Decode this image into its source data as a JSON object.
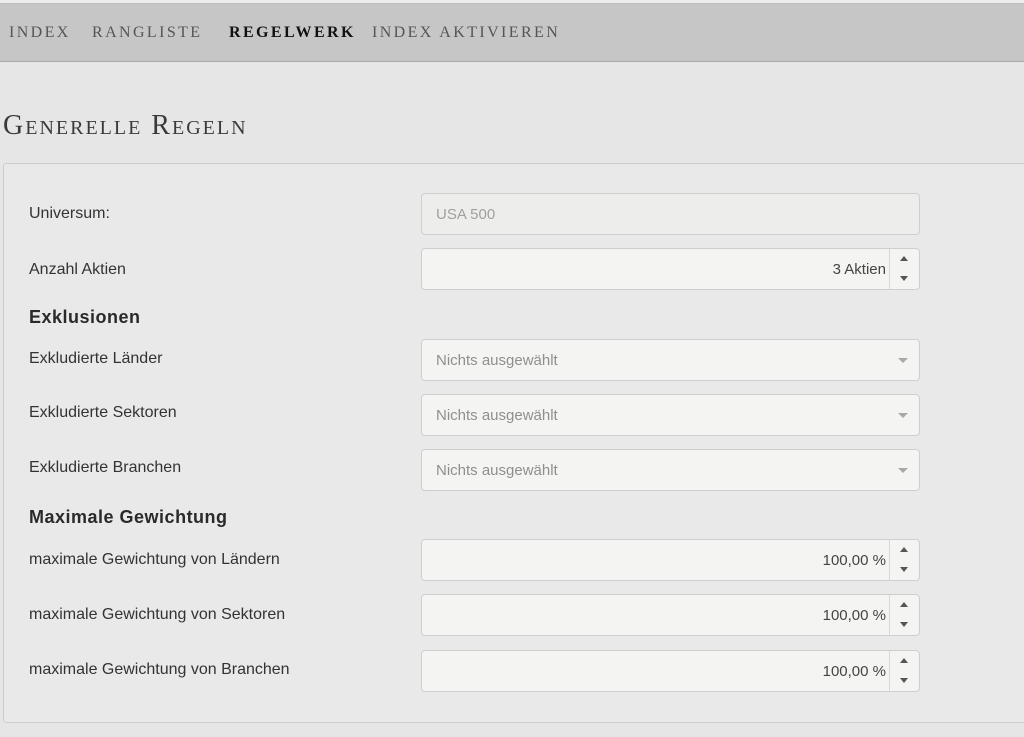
{
  "nav": {
    "items": [
      {
        "label": "INDEX",
        "active": false
      },
      {
        "label": "RANGLISTE",
        "active": false
      },
      {
        "label": "REGELWERK",
        "active": true
      },
      {
        "label": "INDEX AKTIVIEREN",
        "active": false
      }
    ]
  },
  "page_title": "Generelle Regeln",
  "form": {
    "universum": {
      "label": "Universum:",
      "placeholder": "USA 500"
    },
    "anzahl_aktien": {
      "label": "Anzahl Aktien",
      "value": "3 Aktien"
    },
    "exklusionen": {
      "heading": "Exklusionen",
      "laender": {
        "label": "Exkludierte Länder",
        "value": "Nichts ausgewählt"
      },
      "sektoren": {
        "label": "Exkludierte Sektoren",
        "value": "Nichts ausgewählt"
      },
      "branchen": {
        "label": "Exkludierte Branchen",
        "value": "Nichts ausgewählt"
      }
    },
    "max_gewichtung": {
      "heading": "Maximale Gewichtung",
      "laender": {
        "label": "maximale Gewichtung von Ländern",
        "value": "100,00 %"
      },
      "sektoren": {
        "label": "maximale Gewichtung von Sektoren",
        "value": "100,00 %"
      },
      "branchen": {
        "label": "maximale Gewichtung von Branchen",
        "value": "100,00 %"
      }
    }
  },
  "icons": {
    "spinner_up": "chevron-up-icon",
    "spinner_down": "chevron-down-icon",
    "select_caret": "caret-down-icon"
  },
  "colors": {
    "background": "#e6e6e6",
    "navbar": "#c6c6c6",
    "field_bg": "#f4f4f2",
    "active_nav": "#111111"
  }
}
